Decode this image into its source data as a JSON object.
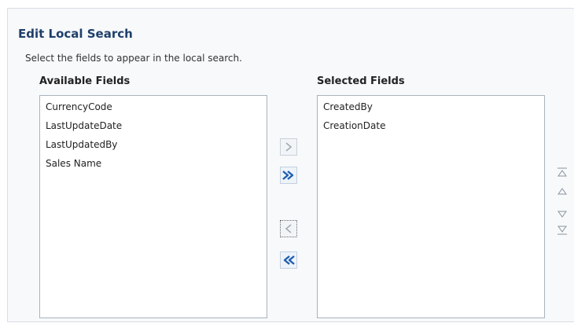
{
  "section": {
    "title": "Edit Local Search",
    "instruction": "Select the fields to appear in the local search."
  },
  "available": {
    "header": "Available Fields",
    "items": [
      "CurrencyCode",
      "LastUpdateDate",
      "LastUpdatedBy",
      "Sales Name"
    ]
  },
  "selected": {
    "header": "Selected Fields",
    "items": [
      "CreatedBy",
      "CreationDate"
    ]
  },
  "shuttle_buttons": [
    {
      "name": "move-selected-button",
      "icon": "chevron-right-icon",
      "state": "disabled"
    },
    {
      "name": "move-all-button",
      "icon": "double-chevron-right-icon",
      "state": "enabled"
    },
    {
      "name": "remove-selected-button",
      "icon": "chevron-left-icon",
      "state": "disabled"
    },
    {
      "name": "remove-all-button",
      "icon": "double-chevron-left-icon",
      "state": "enabled"
    }
  ],
  "reorder_buttons": [
    {
      "name": "move-to-top-button",
      "icon": "move-top-icon"
    },
    {
      "name": "move-up-button",
      "icon": "move-up-icon"
    },
    {
      "name": "move-down-button",
      "icon": "move-down-icon"
    },
    {
      "name": "move-to-bottom-button",
      "icon": "move-bottom-icon"
    }
  ],
  "colors": {
    "accent_blue": "#1f5fb0",
    "title_color": "#1f3f6b",
    "disabled_gray": "#a0a8b0"
  }
}
